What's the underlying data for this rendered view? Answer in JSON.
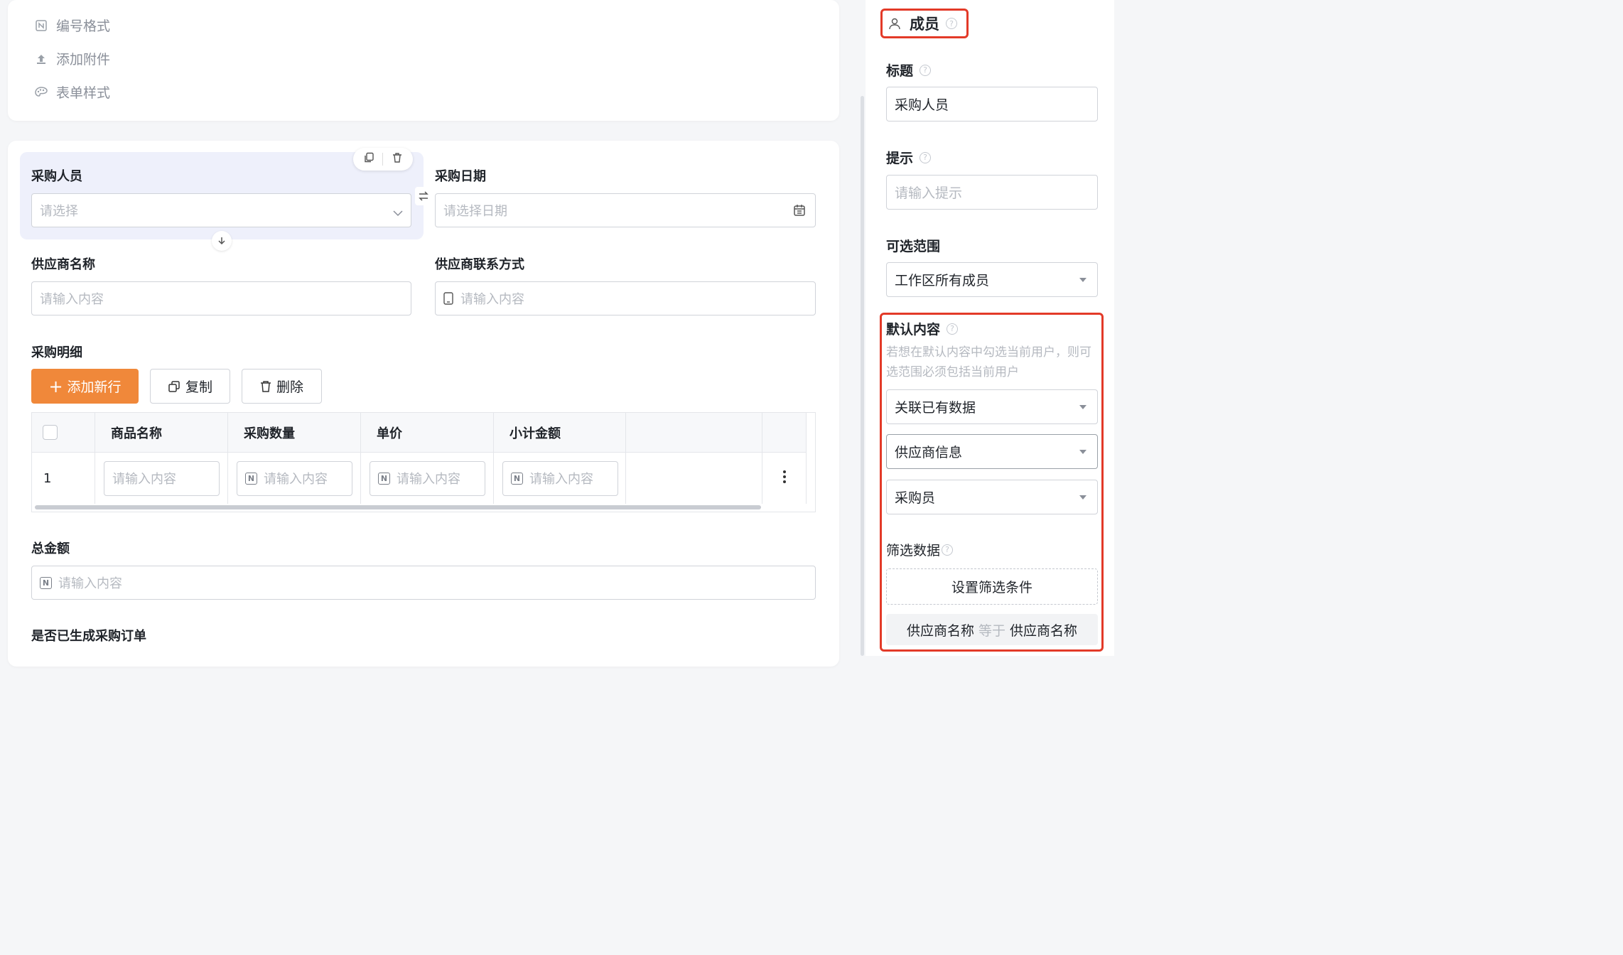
{
  "settings_menu": [
    {
      "icon": "number-format-icon",
      "label": "编号格式"
    },
    {
      "icon": "upload-icon",
      "label": "添加附件"
    },
    {
      "icon": "palette-icon",
      "label": "表单样式"
    }
  ],
  "form": {
    "buyer": {
      "label": "采购人员",
      "placeholder": "请选择"
    },
    "date": {
      "label": "采购日期",
      "placeholder": "请选择日期"
    },
    "supplier_name": {
      "label": "供应商名称",
      "placeholder": "请输入内容"
    },
    "supplier_contact": {
      "label": "供应商联系方式",
      "placeholder": "请输入内容"
    },
    "details": {
      "label": "采购明细",
      "add_button": "添加新行",
      "copy_button": "复制",
      "delete_button": "删除",
      "columns": [
        "商品名称",
        "采购数量",
        "单价",
        "小计金额"
      ],
      "rows": [
        {
          "index": "1",
          "cells": [
            "请输入内容",
            "请输入内容",
            "请输入内容",
            "请输入内容"
          ]
        }
      ]
    },
    "total": {
      "label": "总金额",
      "placeholder": "请输入内容"
    },
    "order_generated": {
      "label": "是否已生成采购订单"
    }
  },
  "panel": {
    "type_label": "成员",
    "title_label": "标题",
    "title_value": "采购人员",
    "hint_label": "提示",
    "hint_placeholder": "请输入提示",
    "range_label": "可选范围",
    "range_value": "工作区所有成员",
    "default_label": "默认内容",
    "default_note": "若想在默认内容中勾选当前用户，则可选范围必须包括当前用户",
    "default_mode": "关联已有数据",
    "default_source": "供应商信息",
    "default_field": "采购员",
    "filter_label": "筛选数据",
    "filter_button": "设置筛选条件",
    "filter_rule": {
      "left": "供应商名称",
      "op": "等于",
      "right": "供应商名称"
    }
  },
  "colors": {
    "accent": "#f0883a",
    "highlight": "#e33a28",
    "selected_bg": "#eef0fb"
  }
}
